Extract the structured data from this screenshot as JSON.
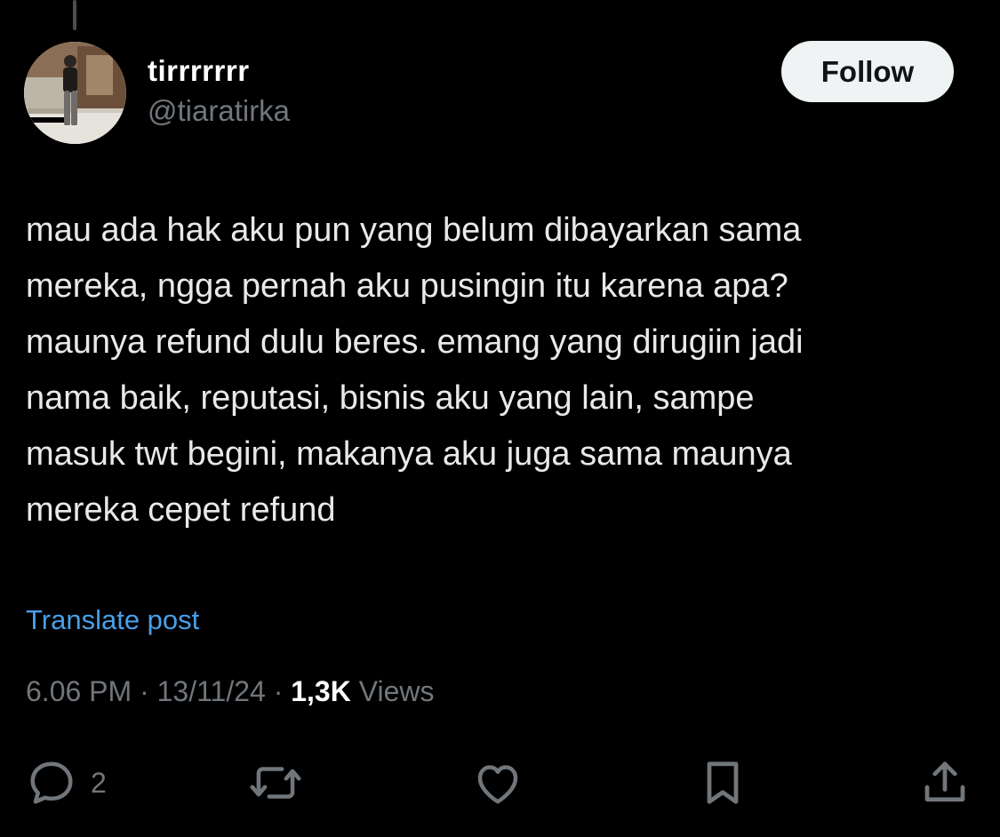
{
  "user": {
    "display_name": "tirrrrrrr",
    "handle": "@tiaratirka"
  },
  "follow_button": {
    "label": "Follow"
  },
  "tweet": {
    "lines": [
      "mau ada hak aku pun yang belum dibayarkan sama",
      "mereka, ngga pernah aku pusingin itu karena apa?",
      "maunya refund dulu beres. emang yang dirugiin jadi",
      "nama baik, reputasi, bisnis aku yang lain, sampe",
      "masuk twt begini, makanya aku juga sama maunya",
      "mereka cepet refund"
    ],
    "translate_label": "Translate post"
  },
  "meta": {
    "time": "6.06 PM",
    "separator": "·",
    "date": "13/11/24",
    "views_count": "1,3K",
    "views_label": "Views"
  },
  "actions": {
    "reply_icon": "reply-icon",
    "reply_count": "2",
    "repost_icon": "repost-icon",
    "like_icon": "heart-icon",
    "bookmark_icon": "bookmark-icon",
    "share_icon": "share-icon"
  },
  "colors": {
    "background": "#000000",
    "text": "#e7e9ea",
    "secondary": "#71767b",
    "link": "#4a9fe8",
    "button_bg": "#eff3f4"
  }
}
